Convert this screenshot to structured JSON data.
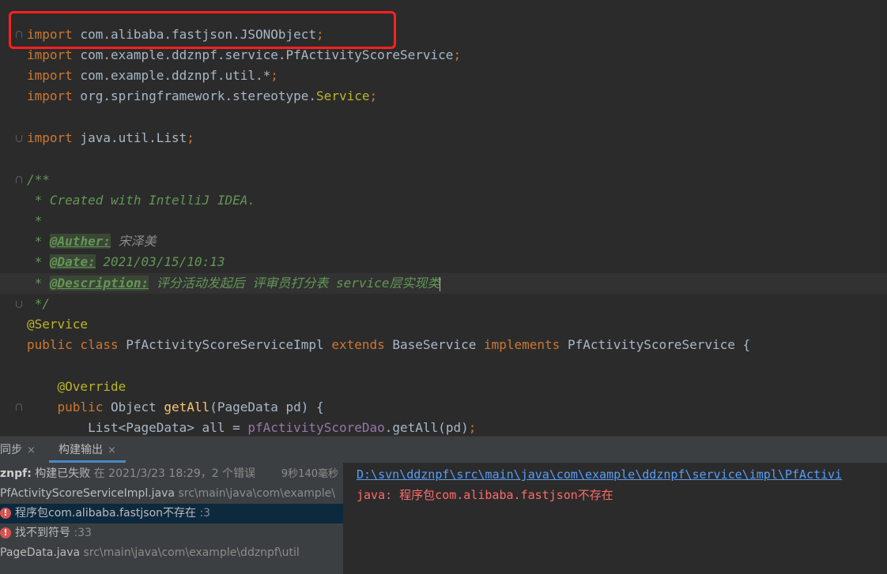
{
  "editor": {
    "lines": {
      "import1": {
        "kw": "import",
        "rest": " com.alibaba.fastjson.JSONObject",
        "semi": ";"
      },
      "import2": {
        "kw": "import",
        "rest": " com.example.ddznpf.service.PfActivityScoreService",
        "semi": ";"
      },
      "import3": {
        "kw": "import",
        "rest": " com.example.ddznpf.util.*",
        "semi": ";"
      },
      "import4": {
        "kw": "import",
        "rest": " org.springframework.stereotype.",
        "cls": "Service",
        "semi": ";"
      },
      "import5": {
        "kw": "import",
        "rest": " java.util.List",
        "semi": ";"
      },
      "doc_open": "/**",
      "doc_created": " * Created with IntelliJ IDEA.",
      "doc_star": " *",
      "doc_author": {
        "prefix": " * ",
        "tag": "@Auther:",
        "value": " 宋泽美"
      },
      "doc_date": {
        "prefix": " * ",
        "tag": "@Date:",
        "value": " 2021/03/15/10:13"
      },
      "doc_desc": {
        "prefix": " * ",
        "tag": "@Description:",
        "value": " 评分活动发起后 评审员打分表 service层实现类"
      },
      "doc_close": " */",
      "annotation_service": "@Service",
      "class_decl": {
        "public": "public",
        "class": " class",
        "name": " PfActivityScoreServiceImpl",
        "extends": " extends",
        "base": " BaseService",
        "implements": " implements",
        "iface": " PfActivityScoreService {"
      },
      "annotation_override": "    @Override",
      "method_decl": {
        "public": "    public",
        "ret": " Object ",
        "name": "getAll",
        "params": "(PageData pd) {"
      },
      "stmt": {
        "lhs": "        List<PageData> all = ",
        "field": "pfActivityScoreDao",
        "rhs": ".getAll(pd)",
        "semi": ";"
      }
    }
  },
  "build": {
    "tabs": [
      {
        "label": "同步",
        "close": "×"
      },
      {
        "label": "构建输出",
        "close": "×"
      }
    ],
    "tree": {
      "summary": {
        "project": "znpf:",
        "status": " 构建已失败",
        "when": " 在 2021/3/23 18:29，2 个错误",
        "duration": "9秒140毫秒"
      },
      "file1": {
        "name": "PfActivityScoreServiceImpl.java",
        "path": " src\\main\\java\\com\\example\\"
      },
      "error1": {
        "icon": "!",
        "text": "程序包com.alibaba.fastjson不存在",
        "line": " :3"
      },
      "error2": {
        "icon": "!",
        "text": "找不到符号",
        "line": " :33"
      },
      "file2": {
        "name": "PageData.java",
        "path": " src\\main\\java\\com\\example\\ddznpf\\util"
      }
    },
    "console": {
      "path_link": "D:\\svn\\ddznpf\\src\\main\\java\\com\\example\\ddznpf\\service\\impl\\PfActivi",
      "error_message": "java: 程序包com.alibaba.fastjson不存在"
    }
  },
  "colors": {
    "editor_bg": "#2b2b2b",
    "keyword": "#cc7832",
    "comment": "#629755",
    "error": "#ff6b68",
    "link": "#589df6",
    "highlight_box": "#ff2020"
  }
}
